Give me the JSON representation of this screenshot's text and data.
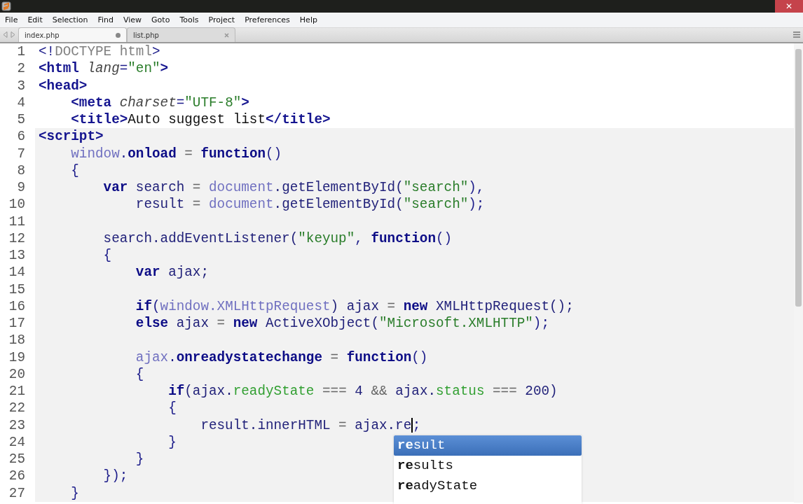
{
  "window": {
    "close_glyph": "✕"
  },
  "menu": [
    "File",
    "Edit",
    "Selection",
    "Find",
    "View",
    "Goto",
    "Tools",
    "Project",
    "Preferences",
    "Help"
  ],
  "tabs": [
    {
      "label": "index.php",
      "selected": true,
      "modified": true
    },
    {
      "label": "list.php",
      "selected": false,
      "modified": false
    }
  ],
  "editor": {
    "lines": [
      {
        "n": "1",
        "shaded": false,
        "tokens": [
          {
            "t": "<!",
            "kind": "punct"
          },
          {
            "t": "DOCTYPE html",
            "kind": "doctype"
          },
          {
            "t": ">",
            "kind": "punct"
          }
        ]
      },
      {
        "n": "2",
        "shaded": false,
        "tokens": [
          {
            "t": "<html",
            "kind": "tag"
          },
          {
            "t": " lang",
            "kind": "attr"
          },
          {
            "t": "=",
            "kind": "punct"
          },
          {
            "t": "\"en\"",
            "kind": "str"
          },
          {
            "t": ">",
            "kind": "tag"
          }
        ]
      },
      {
        "n": "3",
        "shaded": false,
        "tokens": [
          {
            "t": "<head>",
            "kind": "tag"
          }
        ]
      },
      {
        "n": "4",
        "shaded": false,
        "tokens": [
          {
            "t": "    <meta",
            "kind": "tag"
          },
          {
            "t": " charset",
            "kind": "attr"
          },
          {
            "t": "=",
            "kind": "punct"
          },
          {
            "t": "\"UTF-8\"",
            "kind": "str"
          },
          {
            "t": ">",
            "kind": "tag"
          }
        ]
      },
      {
        "n": "5",
        "shaded": false,
        "tokens": [
          {
            "t": "    <title>",
            "kind": "tag"
          },
          {
            "t": "Auto suggest list",
            "kind": "text"
          },
          {
            "t": "</title>",
            "kind": "tag"
          }
        ]
      },
      {
        "n": "6",
        "shaded": true,
        "tokens": [
          {
            "t": "<script>",
            "kind": "tag"
          }
        ]
      },
      {
        "n": "7",
        "shaded": true,
        "tokens": [
          {
            "t": "    window",
            "kind": "obj"
          },
          {
            "t": ".",
            "kind": "punct"
          },
          {
            "t": "onload",
            "kind": "kw"
          },
          {
            "t": " = ",
            "kind": "op"
          },
          {
            "t": "function",
            "kind": "kw"
          },
          {
            "t": "()",
            "kind": "punct"
          }
        ]
      },
      {
        "n": "8",
        "shaded": true,
        "tokens": [
          {
            "t": "    {",
            "kind": "punct"
          }
        ]
      },
      {
        "n": "9",
        "shaded": true,
        "tokens": [
          {
            "t": "        var",
            "kind": "kw"
          },
          {
            "t": " search",
            "kind": "var"
          },
          {
            "t": " = ",
            "kind": "op"
          },
          {
            "t": "document",
            "kind": "obj"
          },
          {
            "t": ".getElementById(",
            "kind": "var"
          },
          {
            "t": "\"search\"",
            "kind": "str"
          },
          {
            "t": "),",
            "kind": "punct"
          }
        ]
      },
      {
        "n": "10",
        "shaded": true,
        "tokens": [
          {
            "t": "            result",
            "kind": "var"
          },
          {
            "t": " = ",
            "kind": "op"
          },
          {
            "t": "document",
            "kind": "obj"
          },
          {
            "t": ".getElementById(",
            "kind": "var"
          },
          {
            "t": "\"search\"",
            "kind": "str"
          },
          {
            "t": ");",
            "kind": "punct"
          }
        ]
      },
      {
        "n": "11",
        "shaded": true
      },
      {
        "n": "12",
        "shaded": true,
        "tokens": [
          {
            "t": "        search.addEventListener(",
            "kind": "var"
          },
          {
            "t": "\"keyup\"",
            "kind": "str"
          },
          {
            "t": ", ",
            "kind": "punct"
          },
          {
            "t": "function",
            "kind": "kw"
          },
          {
            "t": "()",
            "kind": "punct"
          }
        ]
      },
      {
        "n": "13",
        "shaded": true,
        "tokens": [
          {
            "t": "        {",
            "kind": "punct"
          }
        ]
      },
      {
        "n": "14",
        "shaded": true,
        "tokens": [
          {
            "t": "            var",
            "kind": "kw"
          },
          {
            "t": " ajax;",
            "kind": "var"
          }
        ]
      },
      {
        "n": "15",
        "shaded": true
      },
      {
        "n": "16",
        "shaded": true,
        "tokens": [
          {
            "t": "            if",
            "kind": "kw"
          },
          {
            "t": "(",
            "kind": "punct"
          },
          {
            "t": "window.XMLHttpRequest",
            "kind": "obj"
          },
          {
            "t": ") ajax",
            "kind": "var"
          },
          {
            "t": " = ",
            "kind": "op"
          },
          {
            "t": "new",
            "kind": "kw"
          },
          {
            "t": " XMLHttpRequest();",
            "kind": "var"
          }
        ]
      },
      {
        "n": "17",
        "shaded": true,
        "tokens": [
          {
            "t": "            else",
            "kind": "kw"
          },
          {
            "t": " ajax",
            "kind": "var"
          },
          {
            "t": " = ",
            "kind": "op"
          },
          {
            "t": "new",
            "kind": "kw"
          },
          {
            "t": " ActiveXObject(",
            "kind": "var"
          },
          {
            "t": "\"Microsoft.XMLHTTP\"",
            "kind": "str"
          },
          {
            "t": ");",
            "kind": "punct"
          }
        ]
      },
      {
        "n": "18",
        "shaded": true
      },
      {
        "n": "19",
        "shaded": true,
        "tokens": [
          {
            "t": "            ajax",
            "kind": "obj"
          },
          {
            "t": ".",
            "kind": "punct"
          },
          {
            "t": "onreadystatechange",
            "kind": "kw"
          },
          {
            "t": " = ",
            "kind": "op"
          },
          {
            "t": "function",
            "kind": "kw"
          },
          {
            "t": "()",
            "kind": "punct"
          }
        ]
      },
      {
        "n": "20",
        "shaded": true,
        "tokens": [
          {
            "t": "            {",
            "kind": "punct"
          }
        ]
      },
      {
        "n": "21",
        "shaded": true,
        "tokens": [
          {
            "t": "                if",
            "kind": "kw"
          },
          {
            "t": "(ajax.",
            "kind": "var"
          },
          {
            "t": "readyState",
            "kind": "prop"
          },
          {
            "t": " === ",
            "kind": "op"
          },
          {
            "t": "4",
            "kind": "var"
          },
          {
            "t": " && ",
            "kind": "op"
          },
          {
            "t": "ajax.",
            "kind": "var"
          },
          {
            "t": "status",
            "kind": "prop"
          },
          {
            "t": " === ",
            "kind": "op"
          },
          {
            "t": "200)",
            "kind": "var"
          }
        ]
      },
      {
        "n": "22",
        "shaded": true,
        "tokens": [
          {
            "t": "                {",
            "kind": "punct"
          }
        ]
      },
      {
        "n": "23",
        "shaded": true,
        "tokens": [
          {
            "t": "                    result.innerHTML",
            "kind": "var"
          },
          {
            "t": " = ",
            "kind": "op"
          },
          {
            "t": "ajax.re",
            "kind": "var"
          },
          {
            "kind": "caret"
          },
          {
            "t": ";",
            "kind": "punct"
          }
        ]
      },
      {
        "n": "24",
        "shaded": true,
        "tokens": [
          {
            "t": "                }",
            "kind": "punct"
          }
        ]
      },
      {
        "n": "25",
        "shaded": true,
        "tokens": [
          {
            "t": "            }",
            "kind": "punct"
          }
        ]
      },
      {
        "n": "26",
        "shaded": true,
        "tokens": [
          {
            "t": "        });",
            "kind": "punct"
          }
        ]
      },
      {
        "n": "27",
        "shaded": true,
        "tokens": [
          {
            "t": "    }",
            "kind": "punct"
          }
        ]
      }
    ]
  },
  "autocomplete": [
    {
      "label": "**re**sult",
      "selected": true
    },
    {
      "label": "**re**sults",
      "selected": false
    },
    {
      "label": "**re**adyState",
      "selected": false
    }
  ]
}
